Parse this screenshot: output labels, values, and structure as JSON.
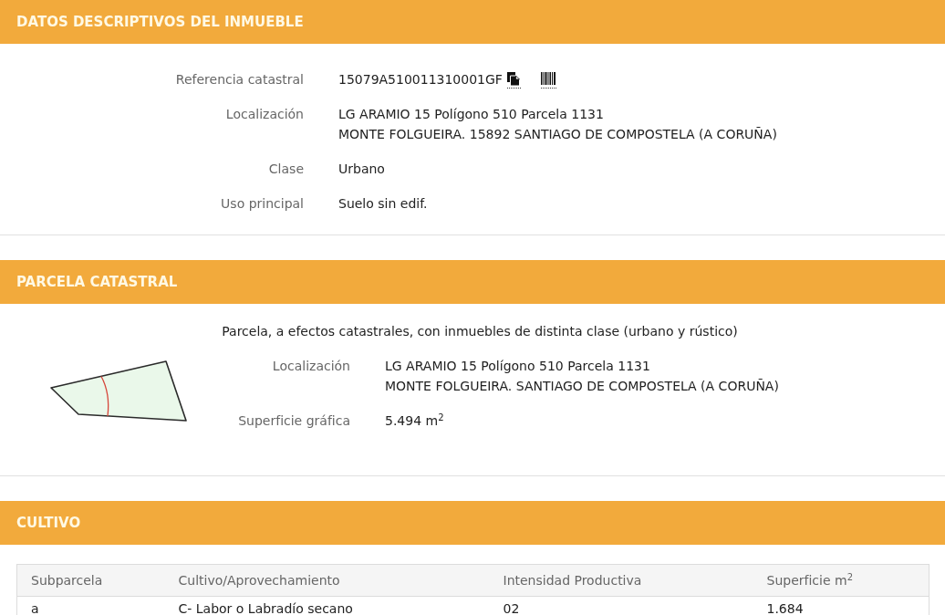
{
  "sections": [
    {
      "kind": "fields",
      "title": "DATOS DESCRIPTIVOS DEL INMUEBLE",
      "fields": [
        {
          "kind": "reference",
          "label": "Referencia catastral",
          "lines": [
            "15079A510011310001GF"
          ]
        },
        {
          "kind": "text",
          "label": "Localización",
          "lines": [
            "LG ARAMIO 15 Polígono 510 Parcela 1131",
            "MONTE FOLGUEIRA. 15892 SANTIAGO DE COMPOSTELA (A CORUÑA)"
          ]
        },
        {
          "kind": "text",
          "label": "Clase",
          "lines": [
            "Urbano"
          ]
        },
        {
          "kind": "text",
          "label": "Uso principal",
          "lines": [
            "Suelo sin edif."
          ]
        }
      ]
    },
    {
      "kind": "parcel",
      "title": "PARCELA CATASTRAL",
      "note": "Parcela, a efectos catastrales, con inmuebles de distinta clase (urbano y rústico)",
      "fields": [
        {
          "kind": "text",
          "label": "Localización",
          "lines": [
            "LG ARAMIO 15 Polígono 510 Parcela 1131",
            "MONTE FOLGUEIRA. SANTIAGO DE COMPOSTELA (A CORUÑA)"
          ]
        },
        {
          "kind": "text",
          "label": "Superficie gráfica",
          "lines": [
            "5.494 m$^{2}$"
          ]
        }
      ]
    },
    {
      "kind": "table",
      "title": "CULTIVO",
      "columns": [
        "Subparcela",
        "Cultivo/Aprovechamiento",
        "Intensidad Productiva",
        "Superficie m$^{2}$"
      ],
      "rows": [
        [
          "a",
          "C- Labor o Labradío secano",
          "02",
          "1.684"
        ]
      ]
    }
  ]
}
